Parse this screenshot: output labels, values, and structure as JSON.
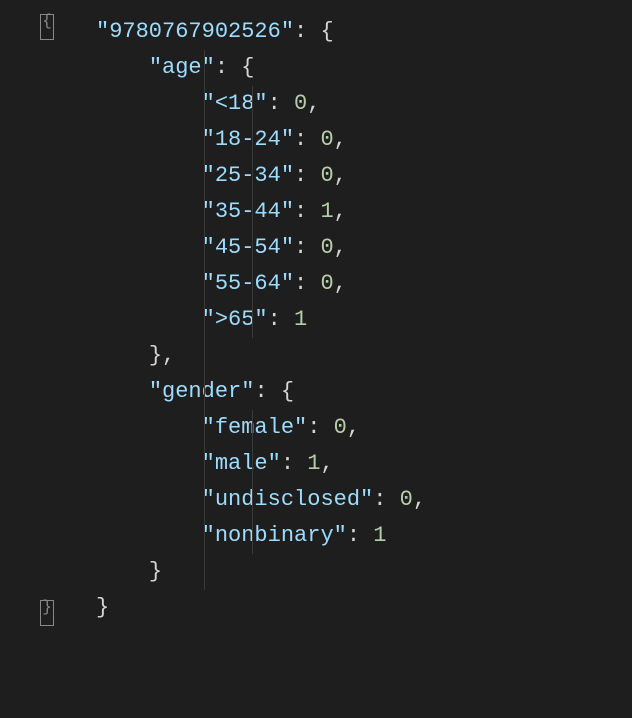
{
  "code": {
    "isbn": "9780767902526",
    "sections": [
      {
        "name": "age",
        "entries": [
          {
            "key": "<18",
            "value": 0
          },
          {
            "key": "18-24",
            "value": 0
          },
          {
            "key": "25-34",
            "value": 0
          },
          {
            "key": "35-44",
            "value": 1
          },
          {
            "key": "45-54",
            "value": 0
          },
          {
            "key": "55-64",
            "value": 0
          },
          {
            "key": ">65",
            "value": 1
          }
        ]
      },
      {
        "name": "gender",
        "entries": [
          {
            "key": "female",
            "value": 0
          },
          {
            "key": "male",
            "value": 1
          },
          {
            "key": "undisclosed",
            "value": 0
          },
          {
            "key": "nonbinary",
            "value": 1
          }
        ]
      }
    ]
  },
  "gutter": {
    "fold_open_top_glyph": "{",
    "fold_open_bottom_glyph": "}"
  }
}
